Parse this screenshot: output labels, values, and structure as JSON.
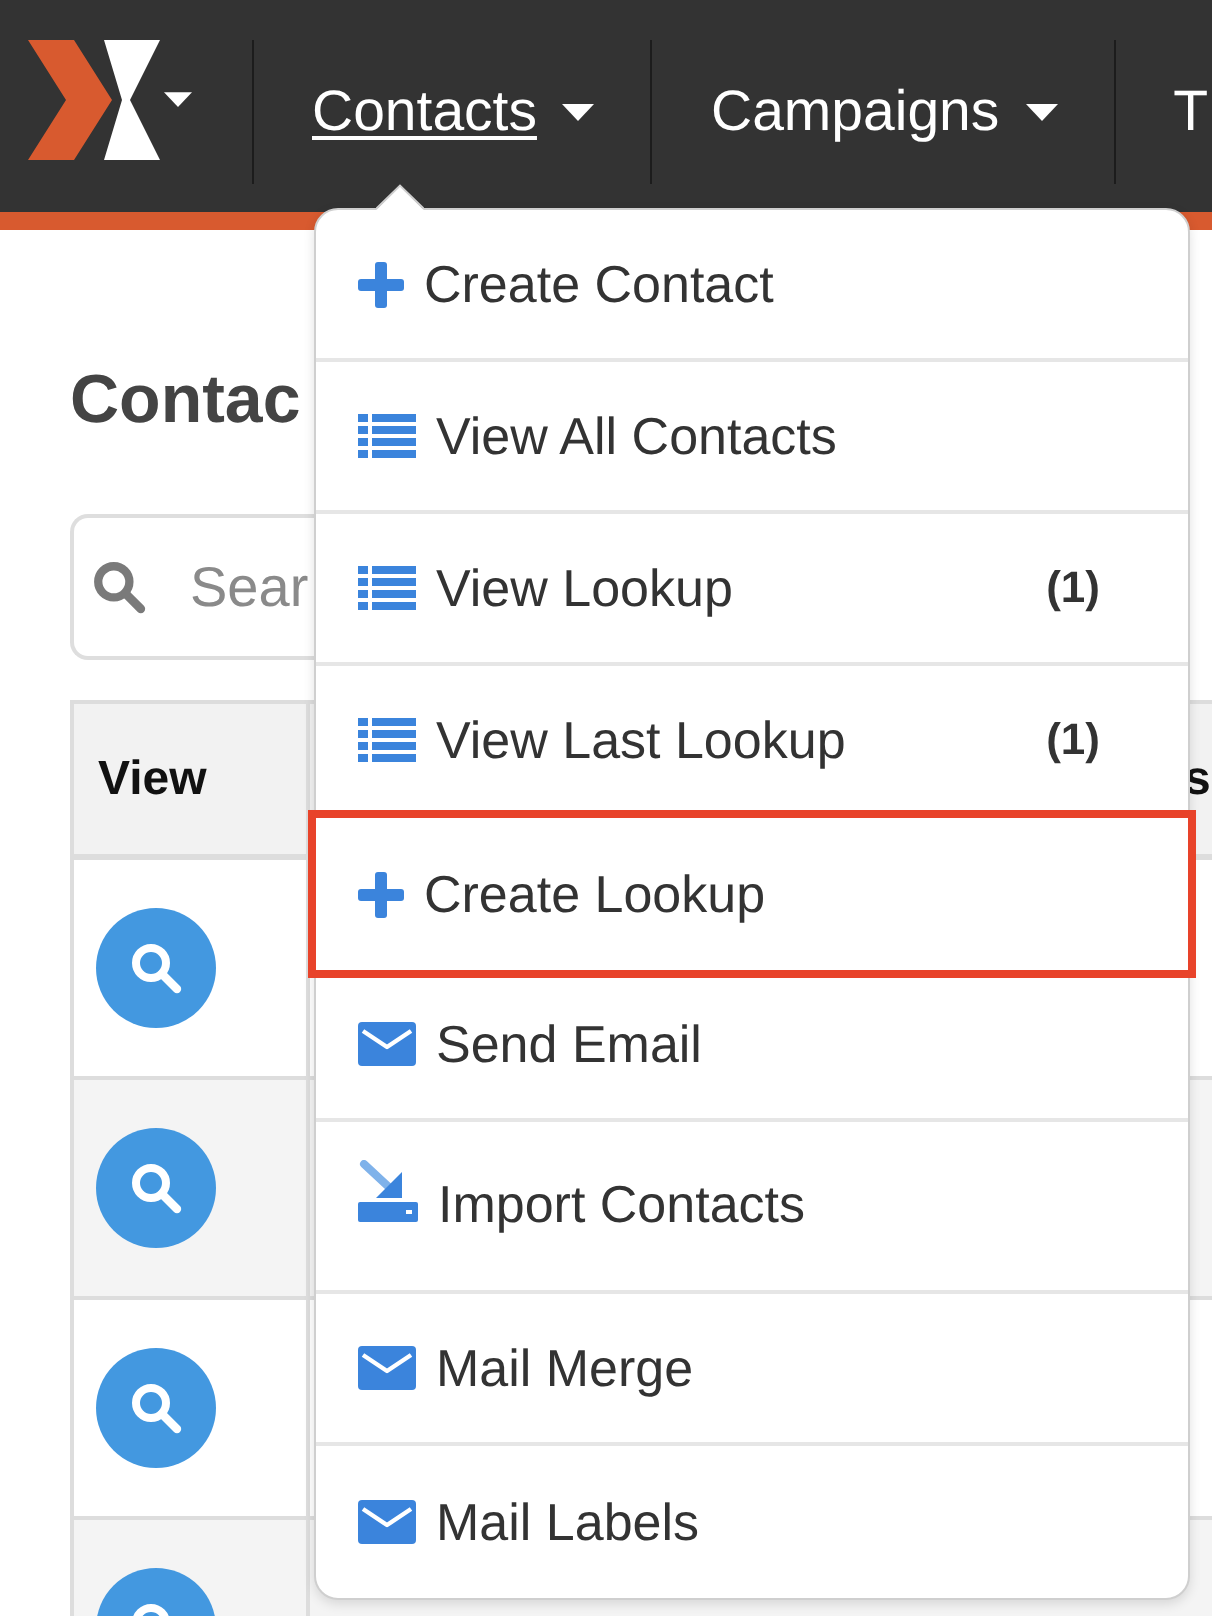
{
  "nav": {
    "items": [
      {
        "label": "Contacts",
        "selected": true,
        "caret": true
      },
      {
        "label": "Campaigns",
        "selected": false,
        "caret": true
      },
      {
        "label": "T",
        "selected": false,
        "caret": false
      }
    ]
  },
  "page": {
    "title": "Contac"
  },
  "search": {
    "placeholder": "Sear"
  },
  "table": {
    "columns": [
      "View",
      "s"
    ],
    "rows": [
      {
        "striped": false
      },
      {
        "striped": true
      },
      {
        "striped": false
      },
      {
        "striped": true
      }
    ]
  },
  "dropdown": {
    "items": [
      {
        "kind": "create",
        "label": "Create Contact",
        "highlighted": false
      },
      {
        "kind": "list",
        "label": "View All Contacts",
        "highlighted": false
      },
      {
        "kind": "list",
        "label": "View Lookup",
        "count": "(1)",
        "highlighted": false
      },
      {
        "kind": "list",
        "label": "View Last Lookup",
        "count": "(1)",
        "highlighted": false
      },
      {
        "kind": "create",
        "label": "Create Lookup",
        "highlighted": true
      },
      {
        "kind": "email",
        "label": "Send Email",
        "highlighted": false
      },
      {
        "kind": "import",
        "label": "Import Contacts",
        "highlighted": false
      },
      {
        "kind": "email",
        "label": "Mail Merge",
        "highlighted": false
      },
      {
        "kind": "email",
        "label": "Mail Labels",
        "highlighted": false
      }
    ]
  }
}
